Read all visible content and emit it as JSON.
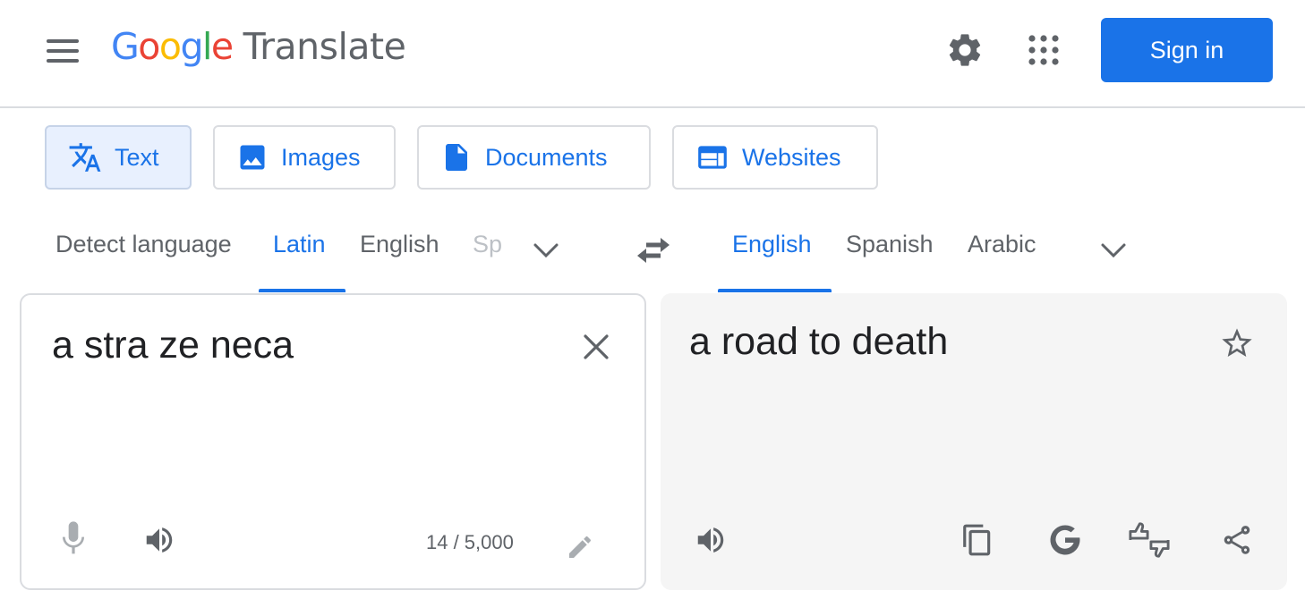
{
  "header": {
    "logo_letters": [
      {
        "ch": "G",
        "color": "#4285f4"
      },
      {
        "ch": "o",
        "color": "#ea4335"
      },
      {
        "ch": "o",
        "color": "#fbbc04"
      },
      {
        "ch": "g",
        "color": "#4285f4"
      },
      {
        "ch": "l",
        "color": "#34a853"
      },
      {
        "ch": "e",
        "color": "#ea4335"
      }
    ],
    "logo_word": "Google",
    "product": "Translate",
    "signin_label": "Sign in",
    "icons": [
      "menu-icon",
      "settings-gear-icon",
      "apps-grid-icon"
    ]
  },
  "modes": [
    {
      "label": "Text",
      "icon": "translate-icon",
      "active": true
    },
    {
      "label": "Images",
      "icon": "image-icon",
      "active": false
    },
    {
      "label": "Documents",
      "icon": "document-icon",
      "active": false
    },
    {
      "label": "Websites",
      "icon": "website-icon",
      "active": false
    }
  ],
  "source_langs": {
    "detect": "Detect language",
    "items": [
      "Latin",
      "English",
      "Sp"
    ],
    "selected": "Latin"
  },
  "target_langs": {
    "items": [
      "English",
      "Spanish",
      "Arabic"
    ],
    "selected": "English"
  },
  "source": {
    "text": "a stra ze neca",
    "char_count": "14 / 5,000"
  },
  "target": {
    "text": "a road to death"
  },
  "colors": {
    "accent": "#1a73e8",
    "active_tab_bg": "#e8f0fe",
    "target_panel_bg": "#f5f5f5",
    "icon_gray": "#5f6368"
  }
}
